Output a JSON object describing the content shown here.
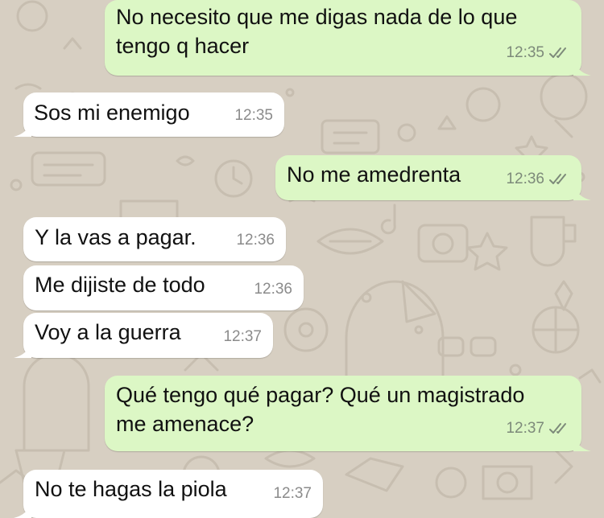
{
  "colors": {
    "outgoing_bubble": "#dcf7c5",
    "incoming_bubble": "#ffffff",
    "wallpaper": "#d7cfc2",
    "doodle": "#c9c0b2",
    "ticks": "#7d8a7a"
  },
  "wallpaper": {
    "style": "doodle-pattern"
  },
  "messages": [
    {
      "direction": "outgoing",
      "lines": [
        "No necesito que me digas nada de lo que",
        "tengo q hacer"
      ],
      "time": "12:35",
      "status_icon": "double-check-icon"
    },
    {
      "direction": "incoming",
      "lines": [
        "Sos mi enemigo"
      ],
      "time": "12:35"
    },
    {
      "direction": "outgoing",
      "lines": [
        "No me amedrenta"
      ],
      "time": "12:36",
      "status_icon": "double-check-icon"
    },
    {
      "direction": "incoming",
      "lines": [
        "Y la vas a pagar."
      ],
      "time": "12:36"
    },
    {
      "direction": "incoming",
      "lines": [
        "Me dijiste de todo"
      ],
      "time": "12:36"
    },
    {
      "direction": "incoming",
      "lines": [
        "Voy a la guerra"
      ],
      "time": "12:37"
    },
    {
      "direction": "outgoing",
      "lines": [
        "Qué tengo qué pagar? Qué un magistrado",
        "me amenace?"
      ],
      "time": "12:37",
      "status_icon": "double-check-icon"
    },
    {
      "direction": "incoming",
      "lines": [
        "No te hagas la piola"
      ],
      "time": "12:37"
    }
  ]
}
